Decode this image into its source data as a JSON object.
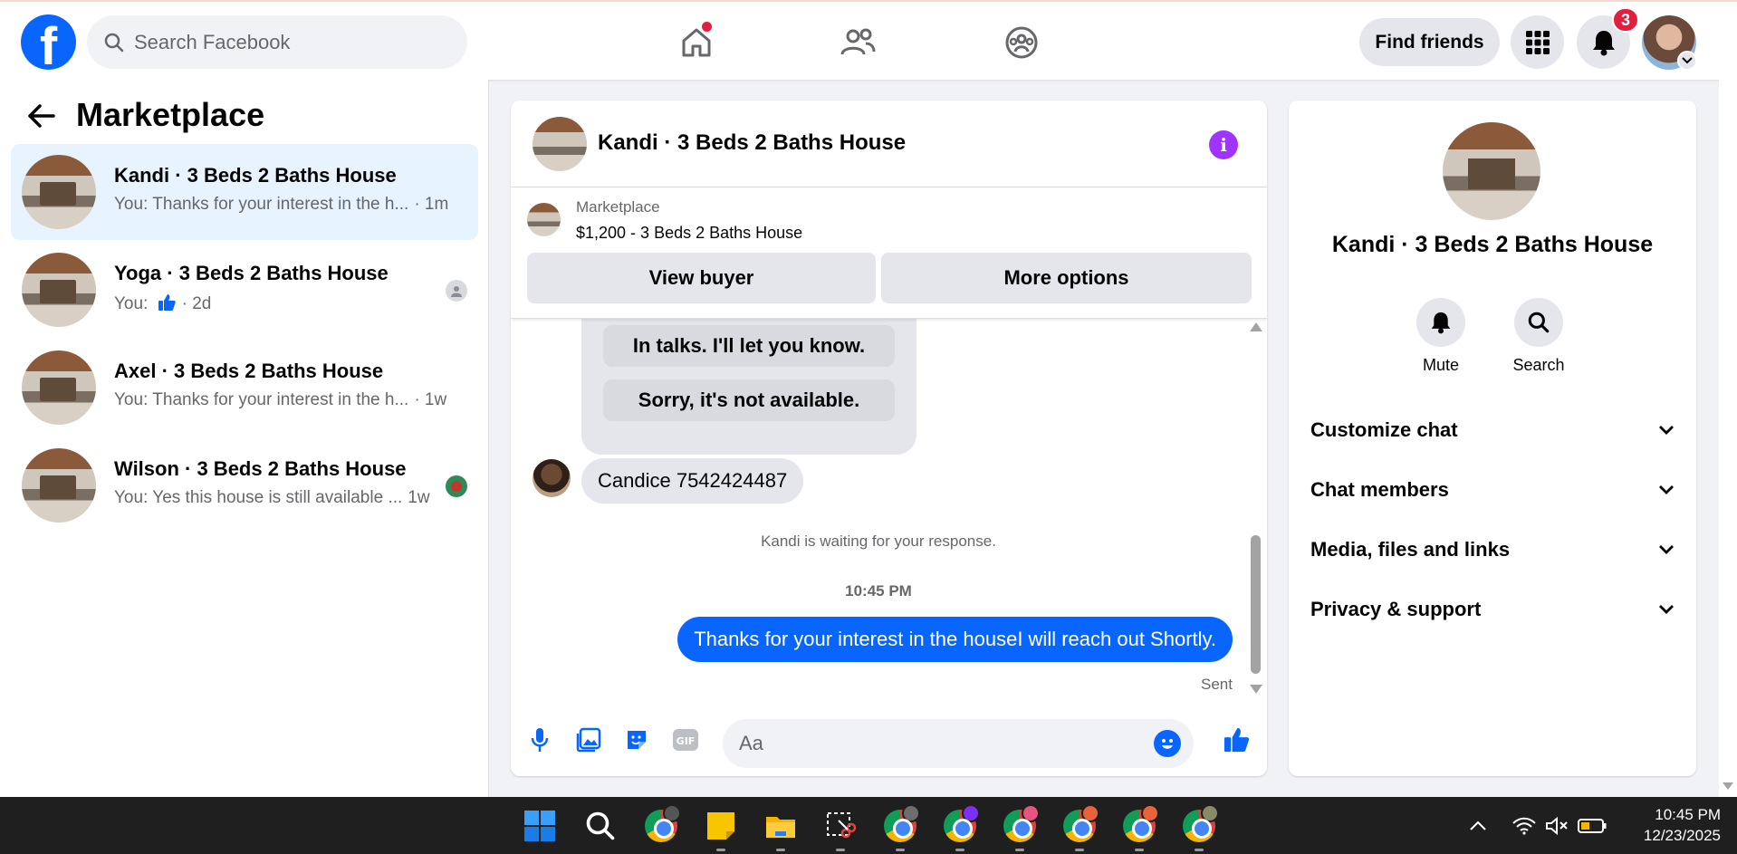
{
  "topbar": {
    "search_placeholder": "Search Facebook",
    "find_friends": "Find friends",
    "notification_count": "3",
    "colors": {
      "brand": "#0866ff",
      "badge": "#e41e3f"
    }
  },
  "sidebar": {
    "title": "Marketplace",
    "conversations": [
      {
        "name": "Kandi · 3 Beds 2 Baths House",
        "snippet": "You: Thanks for your interest in the h...",
        "time": "· 1m",
        "active": true
      },
      {
        "name": "Yoga · 3 Beds 2 Baths House",
        "snippet": "You:",
        "time": "· 2d",
        "active": false
      },
      {
        "name": "Axel · 3 Beds 2 Baths House",
        "snippet": "You: Thanks for your interest in the h...",
        "time": "· 1w",
        "active": false
      },
      {
        "name": "Wilson · 3 Beds 2 Baths House",
        "snippet": "You: Yes this house is still available ...",
        "time": "1w",
        "active": false
      }
    ]
  },
  "chat": {
    "title": "Kandi · 3 Beds 2 Baths House",
    "listing": {
      "label": "Marketplace",
      "price_title": "$1,200 - 3 Beds 2 Baths House",
      "view_buyer": "View buyer",
      "more_options": "More options"
    },
    "quick_replies": [
      "In talks. I'll let you know.",
      "Sorry, it's not available."
    ],
    "incoming": "Candice 7542424487",
    "system_text": "Kandi is waiting for your response.",
    "timestamp": "10:45 PM",
    "outgoing": "Thanks for your interest in the houseI will reach out Shortly.",
    "sent_status": "Sent",
    "composer_placeholder": "Aa"
  },
  "details": {
    "title": "Kandi · 3 Beds 2 Baths House",
    "mute_label": "Mute",
    "search_label": "Search",
    "sections": [
      "Customize chat",
      "Chat members",
      "Media, files and links",
      "Privacy & support"
    ]
  },
  "taskbar": {
    "time": "10:45 PM",
    "date": "12/23/2025"
  }
}
